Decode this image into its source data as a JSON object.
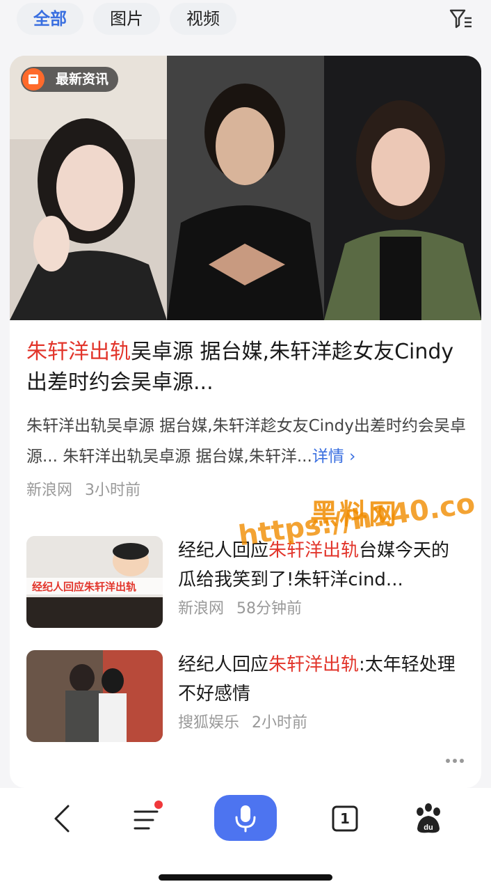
{
  "tabs": [
    {
      "label": "全部"
    },
    {
      "label": "图片"
    },
    {
      "label": "视频"
    }
  ],
  "top_card": {
    "badge": "最新资讯",
    "title_highlight": "朱轩洋出轨",
    "title_rest": "吴卓源 据台媒,朱轩洋趁女友Cindy出差时约会吴卓源...",
    "description": "朱轩洋出轨吴卓源 据台媒,朱轩洋趁女友Cindy出差时约会吴卓源... 朱轩洋出轨吴卓源 据台媒,朱轩洋...",
    "more_link": "详情",
    "source": "新浪网",
    "time": "3小时前"
  },
  "news": [
    {
      "title_prefix": "经纪人回应",
      "title_highlight": "朱轩洋出轨",
      "title_rest": "台媒今天的瓜给我笑到了!朱轩洋cind...",
      "thumb_caption": "经纪人回应朱轩洋出轨",
      "source": "新浪网",
      "time": "58分钟前"
    },
    {
      "title_prefix": "经纪人回应",
      "title_highlight": "朱轩洋出轨",
      "title_rest": ":太年轻处理不好感情",
      "source": "搜狐娱乐",
      "time": "2小时前"
    }
  ],
  "watermark": {
    "line1": "黑料网",
    "line2": "https://h140.co"
  },
  "colors": {
    "accent": "#3a6fe0",
    "highlight": "#e2352b",
    "mic": "#4d74f0",
    "badge_icon": "#ff6a2b"
  },
  "bottom_nav": {
    "tab_count": "1",
    "icons": [
      "back-icon",
      "menu-icon",
      "mic-icon",
      "tabs-icon",
      "baidu-paw-icon"
    ]
  }
}
